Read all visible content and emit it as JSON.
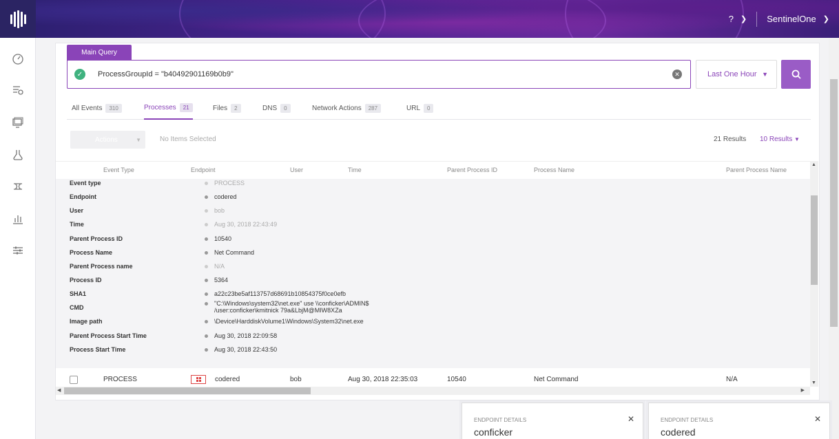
{
  "topbar": {
    "help": "?",
    "account": "SentinelOne"
  },
  "sidebar": {
    "icons": [
      "dashboard-icon",
      "events-icon",
      "devices-icon",
      "threats-icon",
      "network-icon",
      "reports-icon",
      "settings-icon"
    ]
  },
  "query": {
    "tab_label": "Main Query",
    "text": "ProcessGroupId = \"b40492901169b0b9\"",
    "time_range": "Last One Hour"
  },
  "tabs": [
    {
      "label": "All Events",
      "count": "310"
    },
    {
      "label": "Processes",
      "count": "21"
    },
    {
      "label": "Files",
      "count": "2"
    },
    {
      "label": "DNS",
      "count": "0"
    },
    {
      "label": "Network Actions",
      "count": "287"
    },
    {
      "label": "URL",
      "count": "0"
    }
  ],
  "toolbar": {
    "actions": "Actions",
    "selection": "No Items Selected",
    "results": "21 Results",
    "per_page": "10 Results"
  },
  "table": {
    "columns": [
      "Event Type",
      "Endpoint",
      "User",
      "Time",
      "Parent Process ID",
      "Process Name",
      "Parent Process Name"
    ],
    "details": [
      {
        "label": "Event type",
        "value": "PROCESS"
      },
      {
        "label": "Endpoint",
        "value": "codered"
      },
      {
        "label": "User",
        "value": "bob"
      },
      {
        "label": "Time",
        "value": "Aug 30, 2018 22:43:49"
      },
      {
        "label": "Parent Process ID",
        "value": "10540"
      },
      {
        "label": "Process Name",
        "value": "Net Command"
      },
      {
        "label": "Parent Process name",
        "value": "N/A"
      },
      {
        "label": "Process ID",
        "value": "5364"
      },
      {
        "label": "SHA1",
        "value": "a22c23be5af113757d68691b10854375f0ce0efb"
      },
      {
        "label": "CMD",
        "value": "\"C:\\Windows\\system32\\net.exe\" use \\\\conficker\\ADMIN$",
        "value2": "/user:conficker\\kmitnick 79a&LbjM@MIW8XZa"
      },
      {
        "label": "Image path",
        "value": "\\Device\\HarddiskVolume1\\Windows\\System32\\net.exe"
      },
      {
        "label": "Parent Process Start Time",
        "value": "Aug 30, 2018 22:09:58"
      },
      {
        "label": "Process Start Time",
        "value": "Aug 30, 2018 22:43:50"
      }
    ],
    "row": {
      "event_type": "PROCESS",
      "endpoint": "codered",
      "user": "bob",
      "time": "Aug 30, 2018 22:35:03",
      "parent_pid": "10540",
      "process_name": "Net Command",
      "parent_name": "N/A"
    }
  },
  "cards": [
    {
      "title": "ENDPOINT DETAILS",
      "name": "conficker"
    },
    {
      "title": "ENDPOINT DETAILS",
      "name": "codered"
    }
  ],
  "colors": {
    "accent": "#8a44b8",
    "success": "#3fb27f",
    "windows_red": "#dd4444"
  }
}
